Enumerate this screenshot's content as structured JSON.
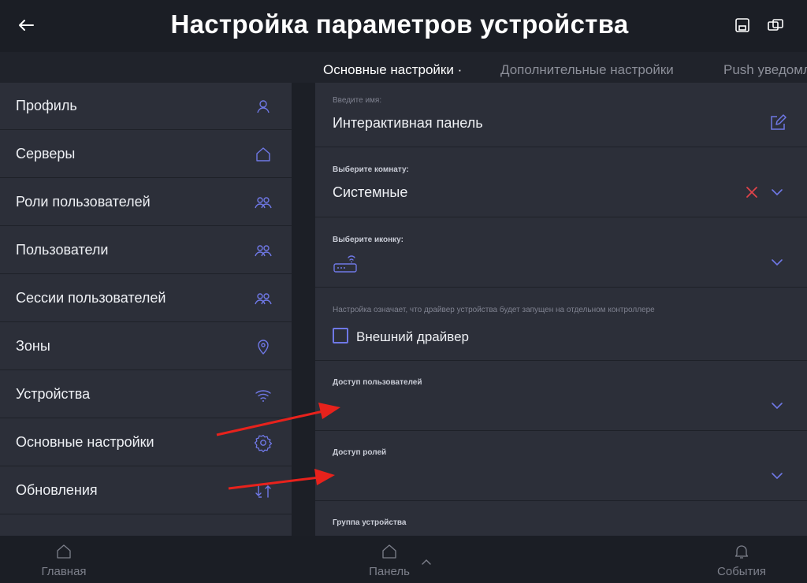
{
  "header": {
    "title": "Настройка параметров устройства",
    "back_icon": "arrow-left-icon",
    "save_icon": "save-icon",
    "copy_icon": "copy-icon"
  },
  "tabs": [
    {
      "label": "Основные настройки ·",
      "active": true
    },
    {
      "label": "Дополнительные настройки",
      "active": false
    },
    {
      "label": "Push уведомления",
      "active": false
    }
  ],
  "sidebar": {
    "items": [
      {
        "label": "Профиль",
        "icon": "user-icon"
      },
      {
        "label": "Серверы",
        "icon": "home-icon"
      },
      {
        "label": "Роли пользователей",
        "icon": "users-icon"
      },
      {
        "label": "Пользователи",
        "icon": "users-icon"
      },
      {
        "label": "Сессии пользователей",
        "icon": "users-icon"
      },
      {
        "label": "Зоны",
        "icon": "location-pin-icon"
      },
      {
        "label": "Устройства",
        "icon": "wifi-icon"
      },
      {
        "label": "Основные настройки",
        "icon": "gear-icon"
      },
      {
        "label": "Обновления",
        "icon": "update-arrows-icon"
      }
    ]
  },
  "form": {
    "name": {
      "label": "Введите имя:",
      "value": "Интерактивная панель",
      "icon": "edit-icon"
    },
    "room": {
      "label": "Выберите комнату:",
      "value": "Системные",
      "clear_icon": "close-icon",
      "dropdown_icon": "chevron-down-icon"
    },
    "icon": {
      "label": "Выберите иконку:",
      "selected_icon": "router-wifi-icon",
      "dropdown_icon": "chevron-down-icon"
    },
    "external_driver": {
      "description": "Настройка означает, что драйвер устройства будет запущен на отдельном контроллере",
      "label": "Внешний драйвер",
      "checked": false
    },
    "user_access": {
      "label": "Доступ пользователей",
      "dropdown_icon": "chevron-down-icon"
    },
    "role_access": {
      "label": "Доступ ролей",
      "dropdown_icon": "chevron-down-icon"
    },
    "device_group": {
      "label": "Группа устройства"
    }
  },
  "bottom_nav": [
    {
      "label": "Главная",
      "icon": "home-icon"
    },
    {
      "label": "Панель",
      "icon": "home-icon"
    },
    {
      "label": "События",
      "icon": "bell-icon"
    }
  ],
  "colors": {
    "accent": "#6f78e6",
    "clear": "#e0434a",
    "annotation": "#e8221c",
    "panel": "#2c2f39",
    "background": "#1c1f26"
  }
}
